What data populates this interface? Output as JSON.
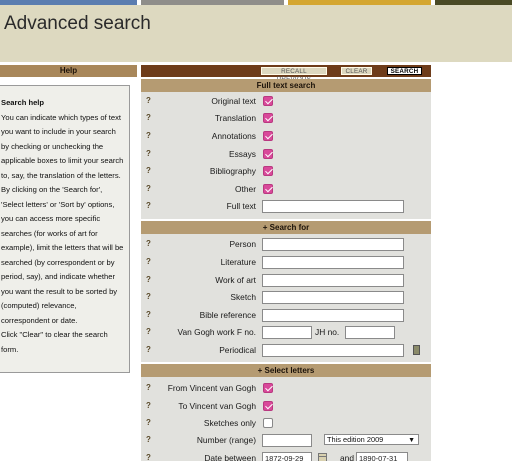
{
  "header": {
    "title": "Advanced search"
  },
  "colors": {
    "header_bg": "#ddd9c0",
    "section_head": "#b59b72",
    "toolbar": "#6e3c1a",
    "checkbox_on": "#d9499a"
  },
  "help": {
    "heading": "Help",
    "title": "Search help",
    "paragraph1": "You can indicate which types of text you want to include in your search by checking or unchecking the applicable boxes to limit your search to, say, the translation of the letters.",
    "paragraph2": "By clicking on the 'Search for', 'Select letters' or 'Sort by' options, you can access more specific searches (for works of art for example), limit the letters that will be searched (by correspondent or by period, say), and indicate whether you want the result to be sorted by (computed) relevance, correspondent or date.",
    "paragraph3": "Click \"Clear\" to clear the search form."
  },
  "toolbar": {
    "recall": "RECALL PREVIOUS",
    "clear": "CLEAR",
    "search": "SEARCH"
  },
  "fulltext": {
    "heading": "Full text search",
    "question": "?",
    "options": [
      {
        "label": "Original text",
        "checked": true
      },
      {
        "label": "Translation",
        "checked": true
      },
      {
        "label": "Annotations",
        "checked": true
      },
      {
        "label": "Essays",
        "checked": true
      },
      {
        "label": "Bibliography",
        "checked": true
      },
      {
        "label": "Other",
        "checked": true
      }
    ],
    "fulltext_label": "Full text",
    "fulltext_value": ""
  },
  "searchfor": {
    "heading": "+ Search for",
    "fields": [
      {
        "label": "Person"
      },
      {
        "label": "Literature"
      },
      {
        "label": "Work of art"
      },
      {
        "label": "Sketch"
      },
      {
        "label": "Bible reference"
      }
    ],
    "workf_label": "Van Gogh work F no.",
    "jh_label": "JH no.",
    "periodical_label": "Periodical"
  },
  "selectletters": {
    "heading": "+ Select letters",
    "from_label": "From Vincent van Gogh",
    "from_checked": true,
    "to_label": "To Vincent van Gogh",
    "to_checked": true,
    "sketches_label": "Sketches only",
    "sketches_checked": false,
    "number_label": "Number (range)",
    "edition_value": "This edition 2009",
    "date_label": "Date between",
    "date_from": "1872-09-29",
    "and_label": "and",
    "date_to": "1890-07-31"
  }
}
